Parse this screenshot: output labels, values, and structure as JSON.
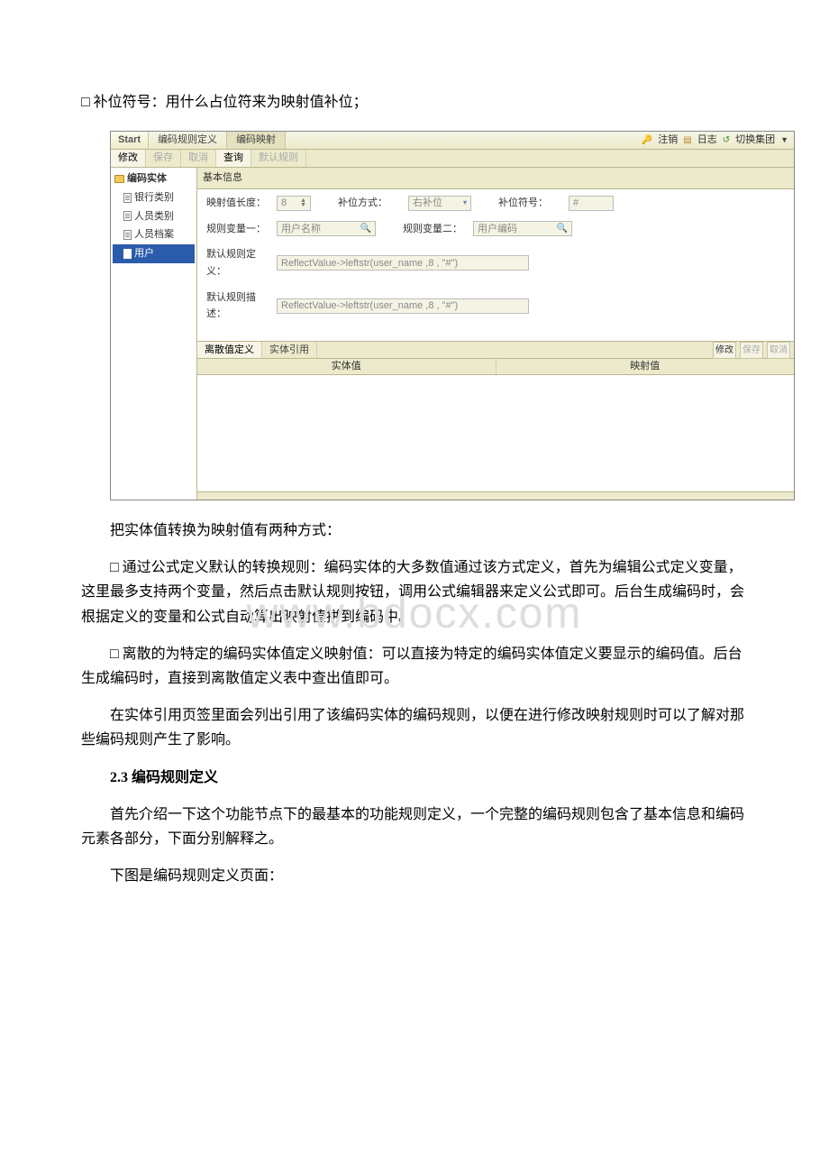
{
  "watermark": "www.bdocx.com",
  "doc": {
    "line1": "□ 补位符号：用什么占位符来为映射值补位；",
    "after_shot_1": "把实体值转换为映射值有两种方式：",
    "after_shot_2": "□ 通过公式定义默认的转换规则：编码实体的大多数值通过该方式定义，首先为编辑公式定义变量，这里最多支持两个变量，然后点击默认规则按钮，调用公式编辑器来定义公式即可。后台生成编码时，会根据定义的变量和公式自动算出映射值拼到编码中。",
    "after_shot_3": "□ 离散的为特定的编码实体值定义映射值：可以直接为特定的编码实体值定义要显示的编码值。后台生成编码时，直接到离散值定义表中查出值即可。",
    "after_shot_4": "在实体引用页签里面会列出引用了该编码实体的编码规则，以便在进行修改映射规则时可以了解对那些编码规则产生了影响。",
    "heading": "2.3 编码规则定义",
    "after_head_1": "首先介绍一下这个功能节点下的最基本的功能规则定义，一个完整的编码规则包含了基本信息和编码元素各部分，下面分别解释之。",
    "after_head_2": "下图是编码规则定义页面："
  },
  "app": {
    "start": "Start",
    "tabs": {
      "ruleDef": "编码规则定义",
      "codeMap": "编码映射"
    },
    "topRight": {
      "logout": "注销",
      "log": "日志",
      "switchGroup": "切换集团"
    },
    "toolbar": {
      "modify": "修改",
      "save": "保存",
      "cancel": "取消",
      "query": "查询",
      "defaultRule": "默认规则"
    },
    "tree": {
      "root": "编码实体",
      "items": [
        "银行类别",
        "人员类别",
        "人员档案",
        "用户"
      ],
      "selectedIndex": 3
    },
    "section": "基本信息",
    "form": {
      "mapLenLabel": "映射值长度：",
      "mapLen": "8",
      "fillModeLabel": "补位方式：",
      "fillMode": "右补位",
      "fillCharLabel": "补位符号：",
      "fillChar": "#",
      "var1Label": "规则变量一：",
      "var1": "用户名称",
      "var2Label": "规则变量二：",
      "var2": "用户编码",
      "defRuleLabel": "默认规则定义：",
      "defRule": "ReflectValue->leftstr(user_name ,8 , \"#\")",
      "defDescLabel": "默认规则描述：",
      "defDesc": "ReflectValue->leftstr(user_name ,8 , \"#\")"
    },
    "subtabs": {
      "discrete": "离散值定义",
      "entityRef": "实体引用"
    },
    "miniBtns": {
      "modify": "修改",
      "save": "保存",
      "cancel": "取消"
    },
    "grid": {
      "col1": "实体值",
      "col2": "映射值"
    }
  }
}
